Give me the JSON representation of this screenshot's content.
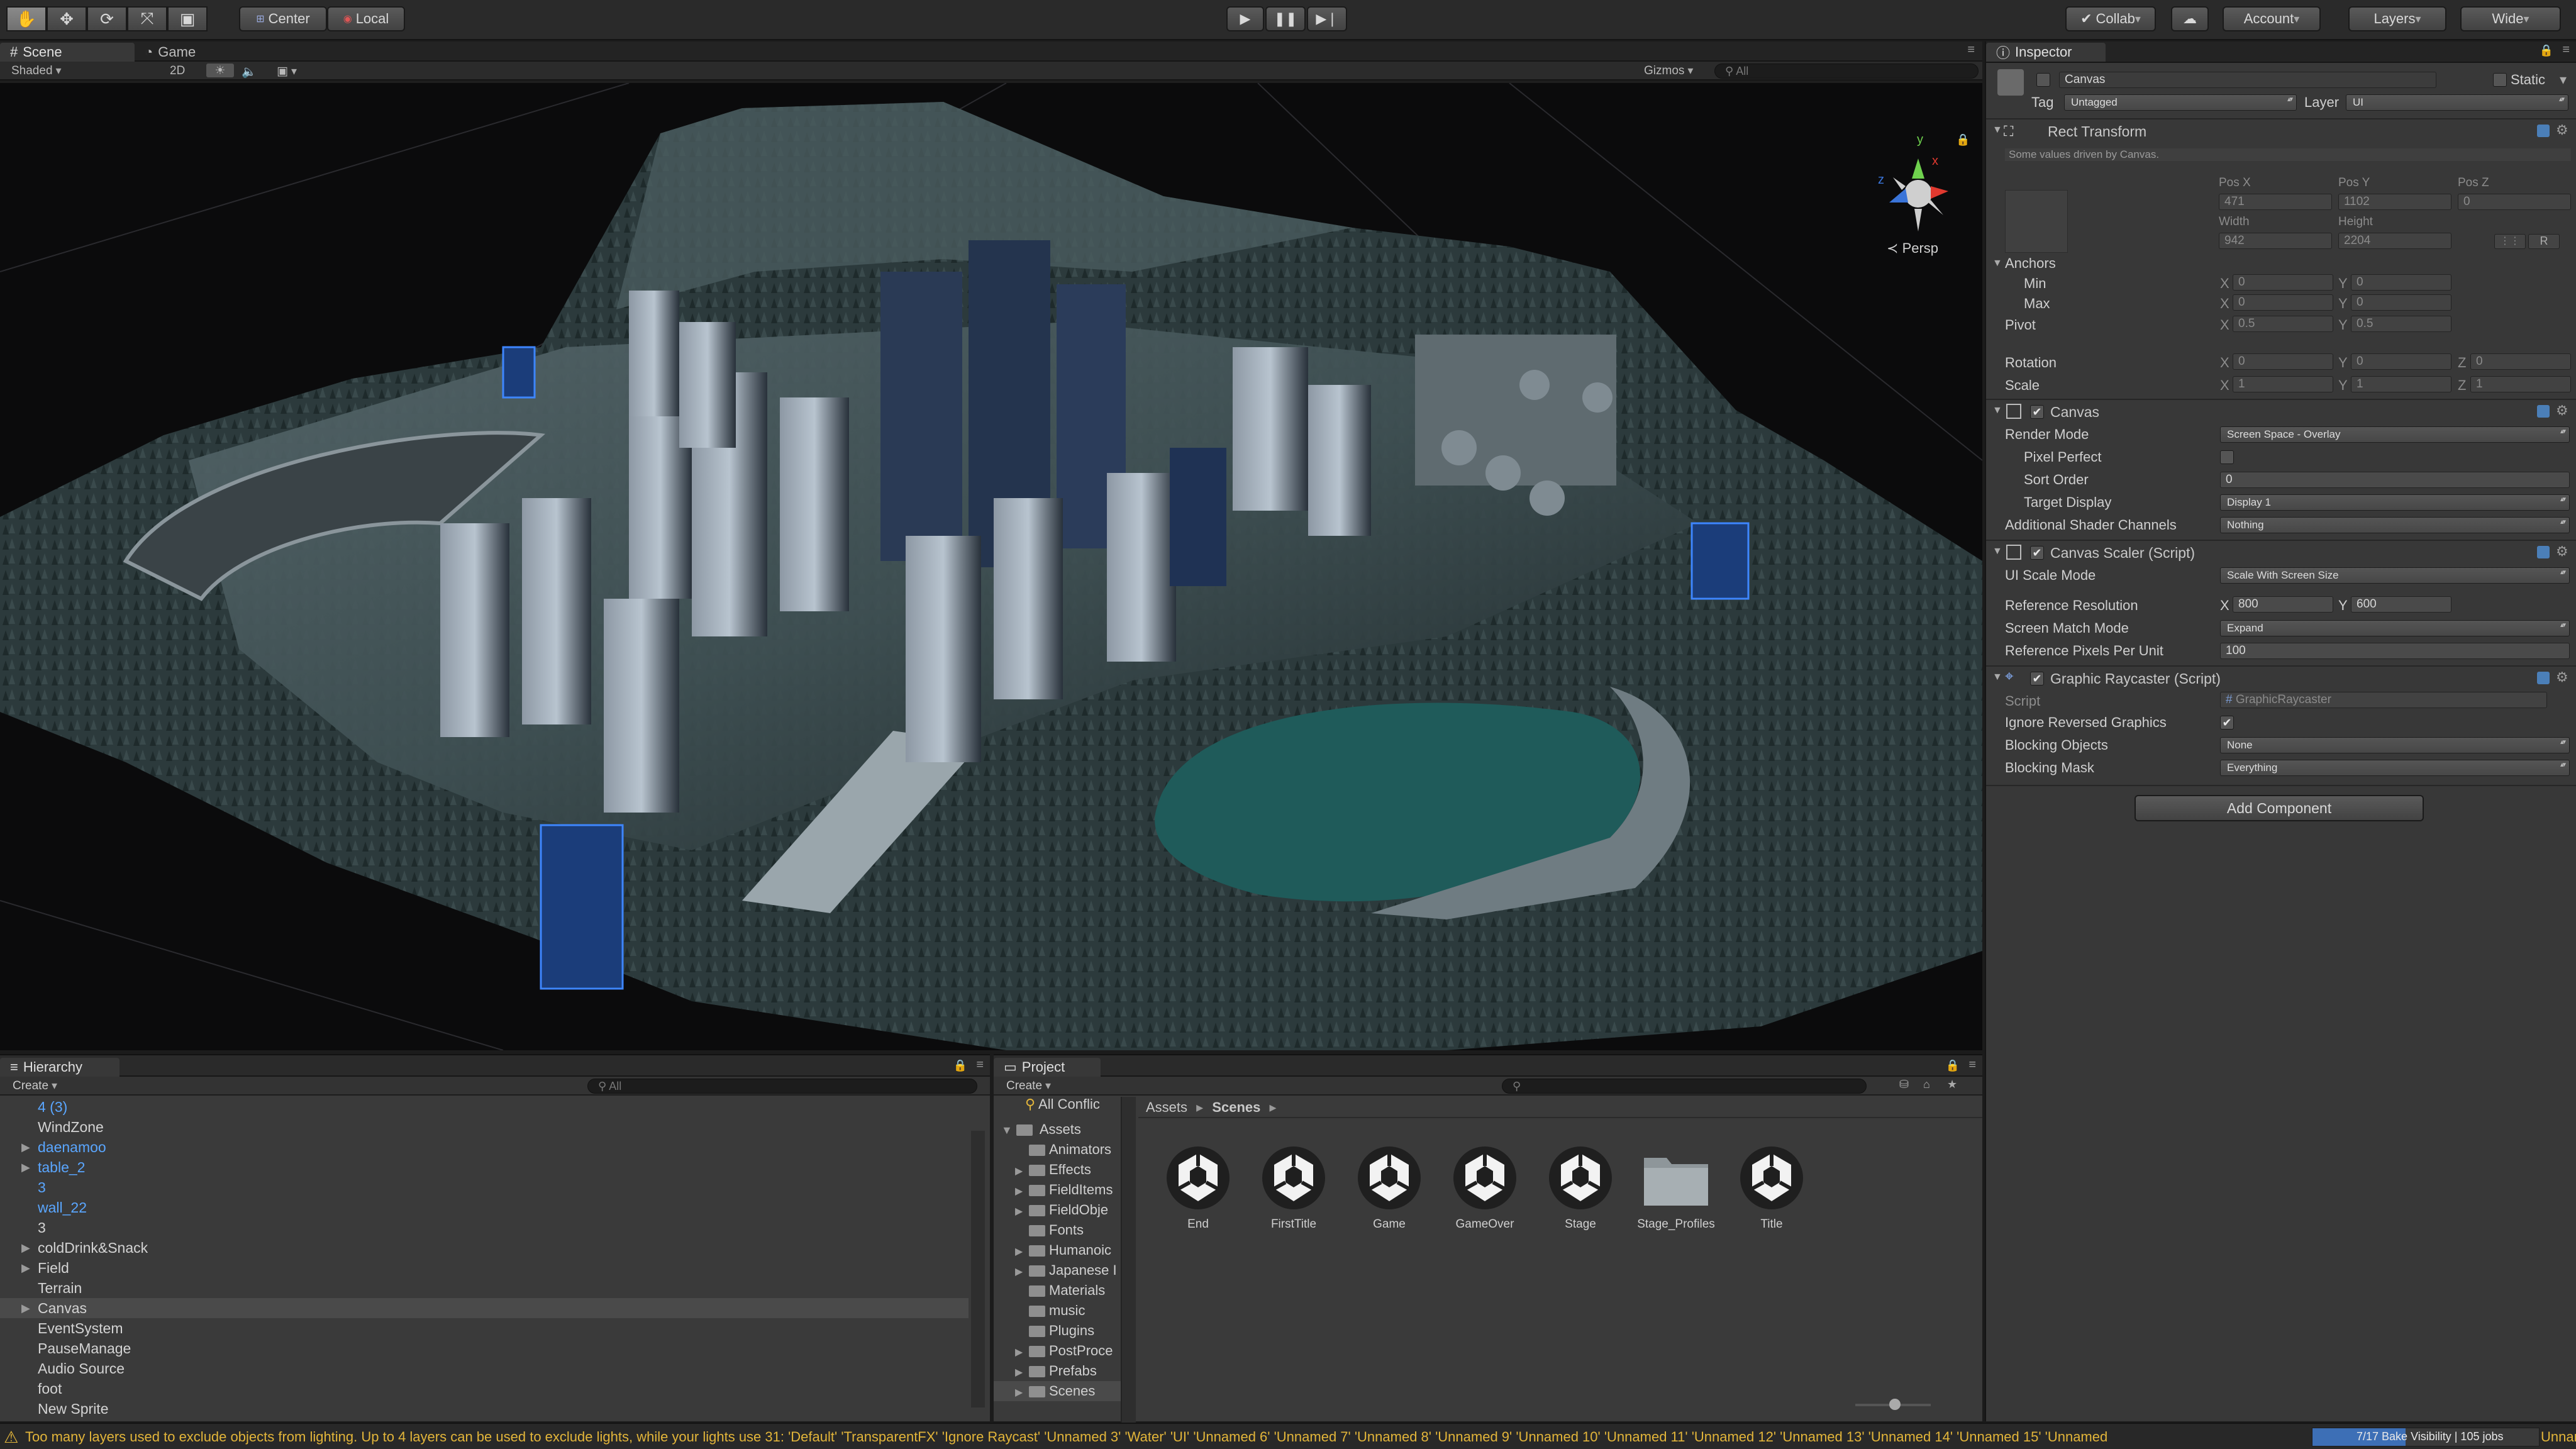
{
  "toolbar": {
    "pivot_label": "Center",
    "space_label": "Local",
    "collab_label": "Collab",
    "account_label": "Account",
    "layers_label": "Layers",
    "layout_label": "Wide"
  },
  "scene": {
    "tabs": [
      "Scene",
      "Game"
    ],
    "shading_mode": "Shaded",
    "mode_2d": "2D",
    "gizmos_label": "Gizmos",
    "search_placeholder": "All",
    "persp_label": "Persp",
    "axis_labels": {
      "y": "y",
      "x": "x",
      "z": "z"
    }
  },
  "hierarchy": {
    "tab": "Hierarchy",
    "create_label": "Create",
    "search_placeholder": "All",
    "items": [
      {
        "label": "4 (3)",
        "blue": true,
        "fold": false
      },
      {
        "label": "WindZone",
        "blue": false,
        "fold": false
      },
      {
        "label": "daenamoo",
        "blue": true,
        "fold": true
      },
      {
        "label": "table_2",
        "blue": true,
        "fold": true
      },
      {
        "label": "3",
        "blue": true,
        "fold": false
      },
      {
        "label": "wall_22",
        "blue": true,
        "fold": false
      },
      {
        "label": "3",
        "blue": false,
        "fold": false
      },
      {
        "label": "coldDrink&Snack",
        "blue": false,
        "fold": true
      },
      {
        "label": "Field",
        "blue": false,
        "fold": true
      },
      {
        "label": "Terrain",
        "blue": false,
        "fold": false
      },
      {
        "label": "Canvas",
        "blue": false,
        "fold": true,
        "selected": true
      },
      {
        "label": "EventSystem",
        "blue": false,
        "fold": false
      },
      {
        "label": "PauseManage",
        "blue": false,
        "fold": false
      },
      {
        "label": "Audio Source",
        "blue": false,
        "fold": false
      },
      {
        "label": "foot",
        "blue": false,
        "fold": false
      },
      {
        "label": "New Sprite",
        "blue": false,
        "fold": false
      }
    ]
  },
  "project": {
    "tab": "Project",
    "create_label": "Create",
    "tree": {
      "top_item": "All Conflic",
      "root": "Assets",
      "folders": [
        {
          "label": "Animators",
          "fold": false
        },
        {
          "label": "Effects",
          "fold": true
        },
        {
          "label": "FieldItems",
          "fold": true
        },
        {
          "label": "FieldObje",
          "fold": true
        },
        {
          "label": "Fonts",
          "fold": false
        },
        {
          "label": "Humanoic",
          "fold": true
        },
        {
          "label": "Japanese I",
          "fold": true
        },
        {
          "label": "Materials",
          "fold": false
        },
        {
          "label": "music",
          "fold": false
        },
        {
          "label": "Plugins",
          "fold": false
        },
        {
          "label": "PostProce",
          "fold": true
        },
        {
          "label": "Prefabs",
          "fold": true
        },
        {
          "label": "Scenes",
          "fold": true,
          "selected": true
        }
      ]
    },
    "breadcrumb": [
      "Assets",
      "Scenes"
    ],
    "assets": [
      {
        "label": "End",
        "type": "unity-scene-icon"
      },
      {
        "label": "FirstTitle",
        "type": "unity-scene-icon"
      },
      {
        "label": "Game",
        "type": "unity-scene-icon"
      },
      {
        "label": "GameOver",
        "type": "unity-scene-icon"
      },
      {
        "label": "Stage",
        "type": "unity-scene-icon"
      },
      {
        "label": "Stage_Profiles",
        "type": "folder-icon"
      },
      {
        "label": "Title",
        "type": "unity-scene-icon"
      }
    ]
  },
  "inspector": {
    "tab": "Inspector",
    "object_name": "Canvas",
    "static_label": "Static",
    "tag_label": "Tag",
    "tag_value": "Untagged",
    "layer_label": "Layer",
    "layer_value": "UI",
    "rect_transform": {
      "title": "Rect Transform",
      "note": "Some values driven by Canvas.",
      "pos_x_label": "Pos X",
      "pos_x": "471",
      "pos_y_label": "Pos Y",
      "pos_y": "1102",
      "pos_z_label": "Pos Z",
      "pos_z": "0",
      "width_label": "Width",
      "width": "942",
      "height_label": "Height",
      "height": "2204",
      "anchors_label": "Anchors",
      "min_label": "Min",
      "min_x": "0",
      "min_y": "0",
      "max_label": "Max",
      "max_x": "0",
      "max_y": "0",
      "pivot_label": "Pivot",
      "pivot_x": "0.5",
      "pivot_y": "0.5",
      "rotation_label": "Rotation",
      "rot_x": "0",
      "rot_y": "0",
      "rot_z": "0",
      "scale_label": "Scale",
      "scale_x": "1",
      "scale_y": "1",
      "scale_z": "1",
      "x": "X",
      "y": "Y",
      "z": "Z",
      "r": "R"
    },
    "canvas": {
      "title": "Canvas",
      "render_mode_label": "Render Mode",
      "render_mode": "Screen Space - Overlay",
      "pixel_perfect_label": "Pixel Perfect",
      "sort_order_label": "Sort Order",
      "sort_order": "0",
      "target_display_label": "Target Display",
      "target_display": "Display 1",
      "shader_channels_label": "Additional Shader Channels",
      "shader_channels": "Nothing"
    },
    "canvas_scaler": {
      "title": "Canvas Scaler (Script)",
      "ui_scale_mode_label": "UI Scale Mode",
      "ui_scale_mode": "Scale With Screen Size",
      "ref_res_label": "Reference Resolution",
      "ref_x": "800",
      "ref_y": "600",
      "match_mode_label": "Screen Match Mode",
      "match_mode": "Expand",
      "ref_ppu_label": "Reference Pixels Per Unit",
      "ref_ppu": "100"
    },
    "graphic_raycaster": {
      "title": "Graphic Raycaster (Script)",
      "script_label": "Script",
      "script_value": "GraphicRaycaster",
      "ignore_reversed_label": "Ignore Reversed Graphics",
      "blocking_objects_label": "Blocking Objects",
      "blocking_objects": "None",
      "blocking_mask_label": "Blocking Mask",
      "blocking_mask": "Everything"
    },
    "add_component_label": "Add Component"
  },
  "status": {
    "warning": "Too many layers used to exclude objects from lighting. Up to 4 layers can be used to exclude lights, while your lights use 31: 'Default' 'TransparentFX' 'Ignore Raycast' 'Unnamed 3' 'Water' 'UI' 'Unnamed 6' 'Unnamed 7' 'Unnamed 8' 'Unnamed 9' 'Unnamed 10' 'Unnamed 11' 'Unnamed 12' 'Unnamed 13' 'Unnamed 14' 'Unnamed 15' 'Unnamed",
    "progress_label": "7/17 Bake Visibility | 105 jobs",
    "progress_fraction": 0.41,
    "trailing": "Unnar"
  },
  "colors": {
    "accent_blue": "#3d6fb6",
    "hierarchy_prefab_blue": "#5aa6ff",
    "warning_yellow": "#e2b53a",
    "water_teal": "#1f5b5a"
  }
}
